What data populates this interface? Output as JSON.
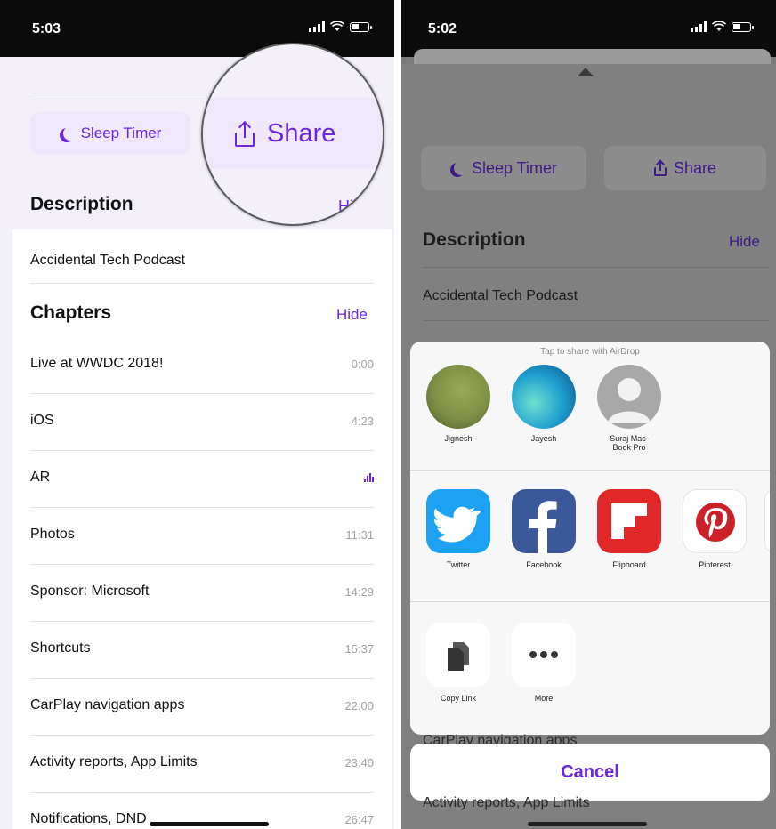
{
  "left": {
    "status": {
      "time": "5:03"
    },
    "buttons": {
      "sleep_timer": "Sleep Timer",
      "share": "Share"
    },
    "description": {
      "header": "Description",
      "toggle": "Hide",
      "text": "Accidental Tech Podcast"
    },
    "chapters": {
      "header": "Chapters",
      "toggle": "Hide",
      "items": [
        {
          "title": "Live at WWDC 2018!",
          "time": "0:00"
        },
        {
          "title": "iOS",
          "time": "4:23"
        },
        {
          "title": "AR",
          "time": ""
        },
        {
          "title": "Photos",
          "time": "11:31"
        },
        {
          "title": "Sponsor: Microsoft",
          "time": "14:29"
        },
        {
          "title": "Shortcuts",
          "time": "15:37"
        },
        {
          "title": "CarPlay navigation apps",
          "time": "22:00"
        },
        {
          "title": "Activity reports, App Limits",
          "time": "23:40"
        },
        {
          "title": "Notifications, DND",
          "time": "26:47"
        }
      ]
    },
    "magnifier": {
      "share": "Share",
      "hide_fragment": "Hide"
    }
  },
  "right": {
    "status": {
      "time": "5:02"
    },
    "buttons": {
      "sleep_timer": "Sleep Timer",
      "share": "Share"
    },
    "description": {
      "header": "Description",
      "toggle": "Hide",
      "text": "Accidental Tech Podcast"
    },
    "share_sheet": {
      "airdrop_hint": "Tap to share with AirDrop",
      "people": [
        {
          "name": "Jignesh",
          "color": "#7d8f45"
        },
        {
          "name": "Jayesh",
          "color": "#1e9fd0"
        },
        {
          "name": "Suraj Mac-\nBook Pro",
          "color": "#a8a8a8"
        }
      ],
      "apps": [
        {
          "name": "Twitter",
          "color": "#1da1f2"
        },
        {
          "name": "Facebook",
          "color": "#3b5998"
        },
        {
          "name": "Flipboard",
          "color": "#e12828"
        },
        {
          "name": "Pinterest",
          "color": "#ffffff"
        }
      ],
      "actions": [
        {
          "name": "Copy Link"
        },
        {
          "name": "More"
        }
      ],
      "cancel": "Cancel"
    },
    "background_rows": [
      "CarPlay navigation apps",
      "Activity reports, App Limits"
    ]
  }
}
